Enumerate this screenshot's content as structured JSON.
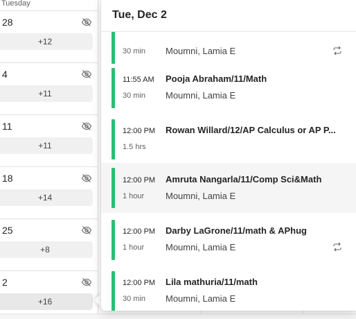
{
  "calendar": {
    "day_header": "Tuesday",
    "weeks": [
      {
        "date": "28",
        "more": "+12"
      },
      {
        "date": "4",
        "more": "+11"
      },
      {
        "date": "11",
        "more": "+11"
      },
      {
        "date": "18",
        "more": "+14"
      },
      {
        "date": "25",
        "more": "+8"
      },
      {
        "date": "2",
        "more": "+16"
      }
    ]
  },
  "popup": {
    "title": "Tue, Dec 2",
    "accent_color": "#2dbd73",
    "events": [
      {
        "time": "",
        "duration": "30 min",
        "title": "",
        "organizer": "Moumni, Lamia E",
        "recurring": true
      },
      {
        "time": "11:55 AM",
        "duration": "30 min",
        "title": "Pooja Abraham/11/Math",
        "organizer": "Moumni, Lamia E",
        "recurring": false
      },
      {
        "time": "12:00 PM",
        "duration": "1.5 hrs",
        "title": "Rowan Willard/12/AP Calculus or AP P...",
        "organizer": "",
        "recurring": false
      },
      {
        "time": "12:00 PM",
        "duration": "1 hour",
        "title": "Amruta Nangarla/11/Comp Sci&Math",
        "organizer": "Moumni, Lamia E",
        "recurring": false
      },
      {
        "time": "12:00 PM",
        "duration": "1 hour",
        "title": "Darby LaGrone/11/math & APhug",
        "organizer": "Moumni, Lamia E",
        "recurring": true
      },
      {
        "time": "12:00 PM",
        "duration": "30 min",
        "title": "Lila mathuria/11/math",
        "organizer": "Moumni, Lamia E",
        "recurring": false
      }
    ]
  }
}
